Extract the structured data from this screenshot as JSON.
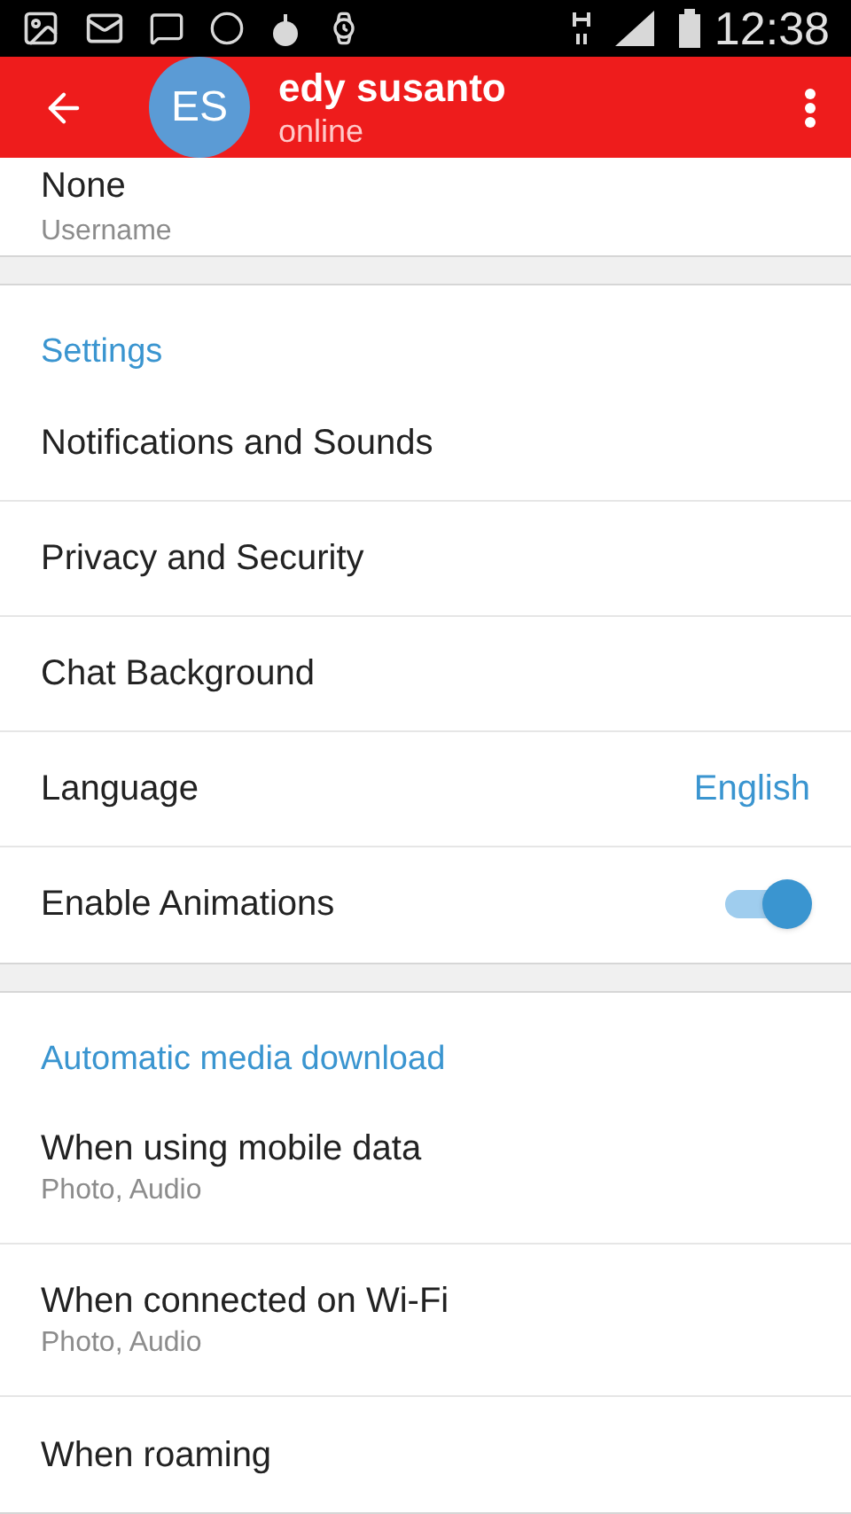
{
  "status_bar": {
    "time": "12:38"
  },
  "header": {
    "avatar_initials": "ES",
    "name": "edy susanto",
    "status": "online"
  },
  "profile": {
    "value": "None",
    "caption": "Username"
  },
  "sections": [
    {
      "title": "Settings",
      "items": [
        {
          "kind": "link",
          "label": "Notifications and Sounds"
        },
        {
          "kind": "link",
          "label": "Privacy and Security"
        },
        {
          "kind": "link",
          "label": "Chat Background"
        },
        {
          "kind": "value",
          "label": "Language",
          "value": "English"
        },
        {
          "kind": "toggle",
          "label": "Enable Animations",
          "on": true
        }
      ]
    },
    {
      "title": "Automatic media download",
      "items": [
        {
          "kind": "detail",
          "label": "When using mobile data",
          "detail": "Photo, Audio"
        },
        {
          "kind": "detail",
          "label": "When connected on Wi-Fi",
          "detail": "Photo, Audio"
        },
        {
          "kind": "link",
          "label": "When roaming"
        }
      ]
    }
  ]
}
